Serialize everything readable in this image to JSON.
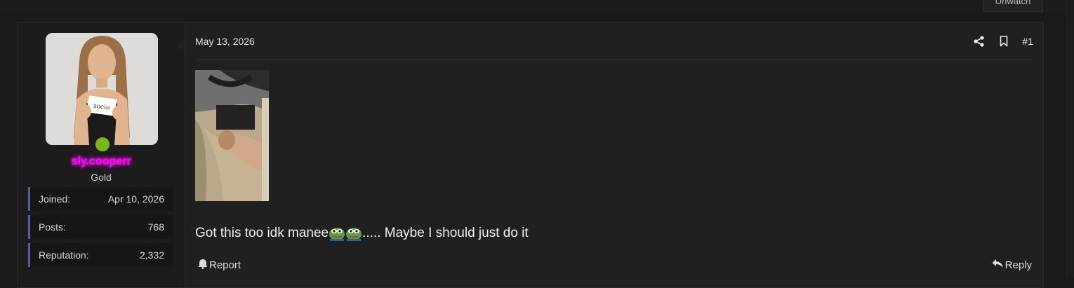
{
  "header": {
    "top_button_label": "Unwatch"
  },
  "user": {
    "username": "sly.cooperr",
    "title": "Gold",
    "avatar_card_text": "socio",
    "stats": [
      {
        "label": "Joined:",
        "value": "Apr 10, 2026"
      },
      {
        "label": "Posts:",
        "value": "768"
      },
      {
        "label": "Reputation:",
        "value": "2,332"
      }
    ]
  },
  "post": {
    "date": "May 13, 2026",
    "number": "#1",
    "message_before": "Got this too idk manee ",
    "message_after": "..... Maybe I should just do it",
    "emoji_icons": [
      "pepe-icon",
      "pepe-icon"
    ],
    "attachment_icon": "attachment-thumbnail"
  },
  "footer": {
    "report_label": "Report",
    "reply_label": "Reply"
  },
  "colors": {
    "username": "#ff00ff",
    "online": "#7cb518",
    "stat_accent": "#5a5a9c",
    "background": "#1a1a1a"
  }
}
